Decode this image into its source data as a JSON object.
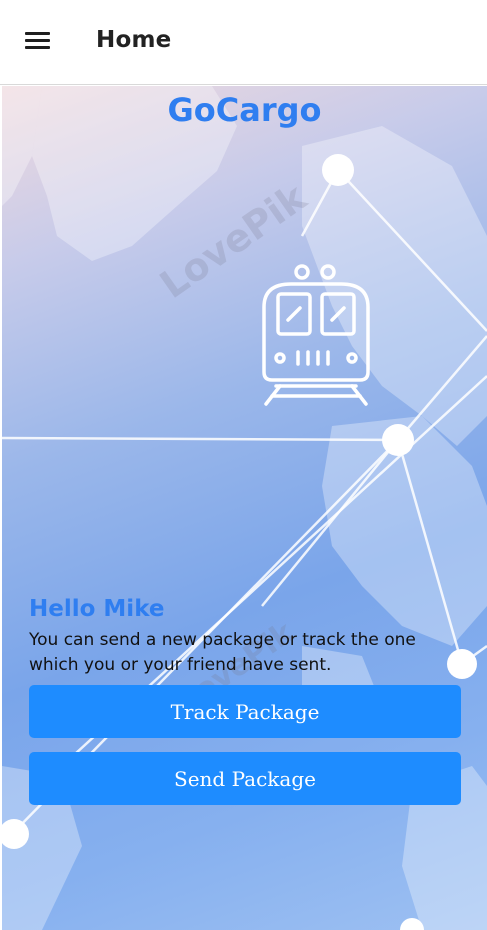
{
  "app_bar": {
    "menu_icon": "hamburger-menu-icon",
    "title": "Home"
  },
  "hero": {
    "brand": "GoCargo",
    "illustration_icon": "train-icon",
    "watermark": "LovePik"
  },
  "welcome": {
    "greeting": "Hello Mike",
    "description": "You can send a new package or track the one which you or your friend have sent."
  },
  "actions": {
    "track_label": "Track Package",
    "send_label": "Send Package"
  },
  "colors": {
    "brand": "#2f7ef0",
    "button": "#1e8cff",
    "button_text": "#ffffff",
    "title_text": "#222222"
  }
}
